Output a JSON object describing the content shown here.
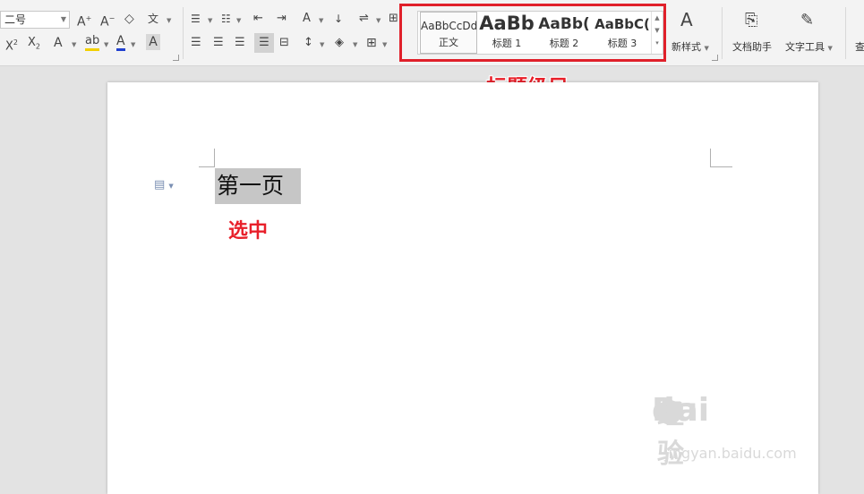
{
  "toolbar": {
    "font_size": "二号",
    "styles": [
      {
        "preview": "AaBbCcDd",
        "name": "正文"
      },
      {
        "preview": "AaBb",
        "name": "标题 1"
      },
      {
        "preview": "AaBb(",
        "name": "标题 2"
      },
      {
        "preview": "AaBbC(",
        "name": "标题 3"
      }
    ],
    "new_style_label": "新样式",
    "doc_assistant_label": "文档助手",
    "text_tools_label": "文字工具",
    "cut_off_label": "查"
  },
  "annotations": {
    "heading_levels": "标题级目",
    "selected": "选中"
  },
  "document": {
    "selected_text": "第一页"
  },
  "watermark": {
    "brand": "Bai",
    "brand2": "du",
    "brand_cn": "经验",
    "url": "jingyan.baidu.com"
  },
  "colors": {
    "annotation_red": "#e0202a",
    "highlight_yellow": "#f2d000",
    "font_color_blue": "#2040d0",
    "selection_gray": "#c6c6c6"
  }
}
